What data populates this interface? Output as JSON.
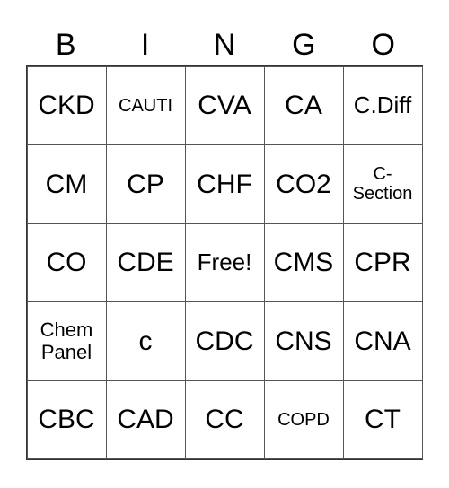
{
  "header": [
    "B",
    "I",
    "N",
    "G",
    "O"
  ],
  "cells": [
    [
      {
        "text": "CKD",
        "size": "l"
      },
      {
        "text": "CAUTI",
        "size": "xs"
      },
      {
        "text": "CVA",
        "size": "l"
      },
      {
        "text": "CA",
        "size": "l"
      },
      {
        "text": "C.Diff",
        "size": "m"
      }
    ],
    [
      {
        "text": "CM",
        "size": "l"
      },
      {
        "text": "CP",
        "size": "l"
      },
      {
        "text": "CHF",
        "size": "l"
      },
      {
        "text": "CO2",
        "size": "l"
      },
      {
        "text": "C-\nSection",
        "size": "xs"
      }
    ],
    [
      {
        "text": "CO",
        "size": "l"
      },
      {
        "text": "CDE",
        "size": "l"
      },
      {
        "text": "Free!",
        "size": "m"
      },
      {
        "text": "CMS",
        "size": "l"
      },
      {
        "text": "CPR",
        "size": "l"
      }
    ],
    [
      {
        "text": "Chem\nPanel",
        "size": "s"
      },
      {
        "text": "c",
        "size": "l"
      },
      {
        "text": "CDC",
        "size": "l"
      },
      {
        "text": "CNS",
        "size": "l"
      },
      {
        "text": "CNA",
        "size": "l"
      }
    ],
    [
      {
        "text": "CBC",
        "size": "l"
      },
      {
        "text": "CAD",
        "size": "l"
      },
      {
        "text": "CC",
        "size": "l"
      },
      {
        "text": "COPD",
        "size": "xs"
      },
      {
        "text": "CT",
        "size": "l"
      }
    ]
  ]
}
